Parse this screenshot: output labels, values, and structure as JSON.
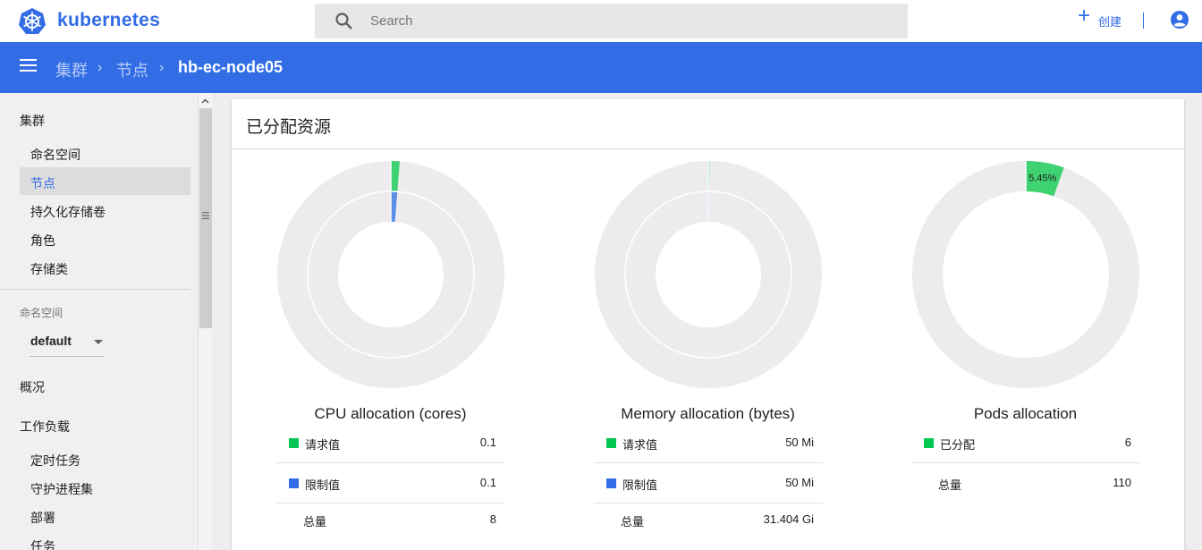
{
  "header": {
    "brand": "kubernetes",
    "search_placeholder": "Search",
    "create_label": "创建"
  },
  "breadcrumb": [
    "集群",
    "节点",
    "hb-ec-node05"
  ],
  "sidebar": {
    "section_cluster": "集群",
    "cluster_items": [
      "命名空间",
      "节点",
      "持久化存储卷",
      "角色",
      "存储类"
    ],
    "selected_item": "节点",
    "namespace_label": "命名空间",
    "namespace_value": "default",
    "overview": "概况",
    "workloads": "工作负载",
    "workload_items": [
      "定时任务",
      "守护进程集",
      "部署",
      "任务"
    ]
  },
  "card": {
    "title": "已分配资源",
    "panels": [
      {
        "title": "CPU allocation (cores)",
        "rows": [
          {
            "name": "请求值",
            "value": "0.1",
            "color": "#00c752"
          },
          {
            "name": "限制值",
            "value": "0.1",
            "color": "#326de6"
          },
          {
            "name": "总量",
            "value": "8"
          }
        ],
        "outer_fraction": 0.0125,
        "outer_color": "#3fd272",
        "inner_fraction": 0.0125,
        "inner_color": "#5b8fe8"
      },
      {
        "title": "Memory allocation (bytes)",
        "rows": [
          {
            "name": "请求值",
            "value": "50 Mi",
            "color": "#00c752"
          },
          {
            "name": "限制值",
            "value": "50 Mi",
            "color": "#326de6"
          },
          {
            "name": "总量",
            "value": "31.404 Gi"
          }
        ],
        "outer_fraction": 0.0016,
        "outer_color": "#3fd272",
        "inner_fraction": 0.0016,
        "inner_color": "#5b8fe8"
      },
      {
        "title": "Pods allocation",
        "rows": [
          {
            "name": "已分配",
            "value": "6",
            "color": "#00c752"
          },
          {
            "name": "总量",
            "value": "110"
          }
        ],
        "outer_fraction": 0.0545,
        "outer_color": "#3fd272",
        "outer_label": "5.45%"
      }
    ]
  },
  "colors": {
    "accent": "#326de6",
    "donut_track": "#eeebee",
    "requested": "#00c752",
    "limit": "#326de6"
  }
}
